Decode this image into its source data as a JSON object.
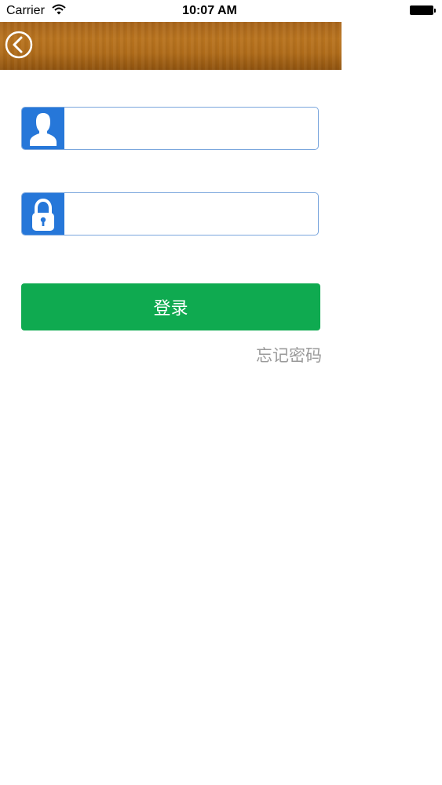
{
  "status_bar": {
    "carrier": "Carrier",
    "time": "10:07 AM",
    "wifi_icon": "wifi-icon",
    "battery_icon": "battery-icon"
  },
  "nav_bar": {
    "back_icon": "chevron-left-circle-icon"
  },
  "form": {
    "username": {
      "value": "",
      "icon": "user-icon"
    },
    "password": {
      "value": "",
      "icon": "lock-icon"
    },
    "login_label": "登录",
    "forgot_label": "忘记密码"
  },
  "colors": {
    "nav_wood": "#b06c1a",
    "field_icon_bg": "#2677d9",
    "field_border": "#7aa6dd",
    "login_button": "#0faa50",
    "forgot_text": "#9a9a9a"
  }
}
